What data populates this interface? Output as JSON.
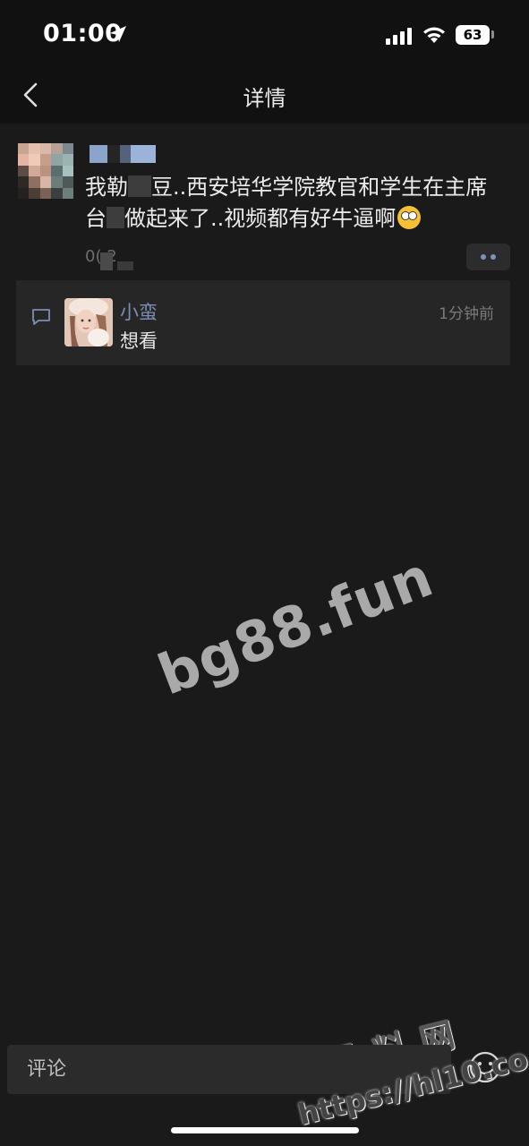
{
  "status_bar": {
    "time": "01:00",
    "battery": "63",
    "icons": [
      "location-arrow-icon",
      "cellular-signal-icon",
      "wifi-icon",
      "battery-icon"
    ]
  },
  "nav": {
    "title": "详情",
    "back_icon": "chevron-left-icon"
  },
  "post": {
    "text_part1": "我勒",
    "text_part2": "豆..西安培华学院教官和学生在主席",
    "text_part3": "台",
    "text_part4": "做起来了..视频都有好牛逼啊",
    "emoji": "flushed-face-emoji",
    "time": "0( 2",
    "more_icon": "two-dots-icon"
  },
  "comment": {
    "icon": "comment-bubble-icon",
    "author": "小蛮",
    "time": "1分钟前",
    "text": "想看"
  },
  "watermarks": {
    "main": "bg88.fun",
    "logo": "黑料网",
    "url": "https://hl10.co"
  },
  "input": {
    "placeholder": "评论",
    "emoji_icon": "smiley-icon"
  },
  "colors": {
    "background": "#1a1a1a",
    "header": "#111111",
    "card": "#262626",
    "link": "#7b8fb4",
    "text": "#ececec"
  }
}
